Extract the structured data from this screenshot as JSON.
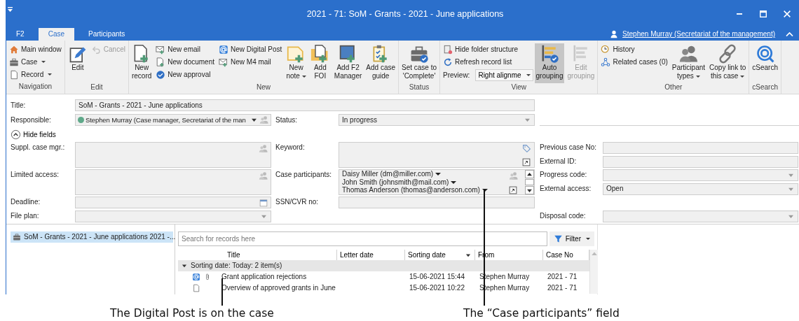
{
  "window": {
    "title": "2021 - 71: SoM - Grants - 2021 - June applications"
  },
  "tabs": [
    {
      "label": "F2",
      "selected": false
    },
    {
      "label": "Case",
      "selected": true
    },
    {
      "label": "Participants",
      "selected": false
    }
  ],
  "user": {
    "label": "Stephen Murray (Secretariat of the management)"
  },
  "ribbon": {
    "groups": [
      {
        "label": "Navigation",
        "items": [
          {
            "kind": "small",
            "label": "Main window",
            "disabled": false,
            "on": false
          },
          {
            "kind": "small",
            "label": "Case",
            "dropdown": true,
            "disabled": false,
            "on": false
          },
          {
            "kind": "small",
            "label": "Record",
            "dropdown": true,
            "disabled": false,
            "on": false
          }
        ]
      },
      {
        "label": "Edit",
        "items": [
          {
            "kind": "large",
            "label": "Edit",
            "disabled": false,
            "on": false
          },
          {
            "kind": "small",
            "label": "Cancel",
            "disabled": true,
            "on": false
          }
        ]
      },
      {
        "label": "New",
        "items": [
          {
            "kind": "large",
            "label": "New\nrecord",
            "disabled": false,
            "on": false
          },
          {
            "kind": "small",
            "label": "New email",
            "disabled": false,
            "on": false
          },
          {
            "kind": "small",
            "label": "New document",
            "disabled": false,
            "on": false
          },
          {
            "kind": "small",
            "label": "New approval",
            "disabled": false,
            "on": false
          },
          {
            "kind": "small",
            "label": "New Digital Post",
            "disabled": false,
            "on": false
          },
          {
            "kind": "small",
            "label": "New M4 mail",
            "disabled": false,
            "on": false
          },
          {
            "kind": "large",
            "label": "New\nnote",
            "dropdown": true,
            "disabled": false,
            "on": false
          },
          {
            "kind": "large",
            "label": "Add\nFOI",
            "disabled": false,
            "on": false
          },
          {
            "kind": "large",
            "label": "Add F2\nManager",
            "disabled": false,
            "on": false
          },
          {
            "kind": "large",
            "label": "Add case\nguide",
            "disabled": false,
            "on": false
          }
        ]
      },
      {
        "label": "Status",
        "items": [
          {
            "kind": "large",
            "label": "Set case to\n'Complete'",
            "disabled": false,
            "on": false
          }
        ]
      },
      {
        "label": "View",
        "items": [
          {
            "kind": "small",
            "label": "Hide folder structure",
            "disabled": false,
            "on": false
          },
          {
            "kind": "small",
            "label": "Refresh record list",
            "disabled": false,
            "on": false
          },
          {
            "kind": "combo",
            "label": "Preview:",
            "value": "Right alignme",
            "disabled": false,
            "on": false
          },
          {
            "kind": "large",
            "label": "Auto\ngrouping",
            "disabled": false,
            "on": true
          },
          {
            "kind": "large",
            "label": "Edit\ngrouping",
            "disabled": true,
            "on": false
          }
        ]
      },
      {
        "label": "Other",
        "items": [
          {
            "kind": "small",
            "label": "History",
            "disabled": false,
            "on": false
          },
          {
            "kind": "small",
            "label": "Related cases (0)",
            "disabled": false,
            "on": false
          },
          {
            "kind": "large",
            "label": "Participant\ntypes",
            "dropdown": true,
            "disabled": false,
            "on": false
          },
          {
            "kind": "large",
            "label": "Copy link to\nthis case",
            "dropdown": true,
            "disabled": false,
            "on": false
          }
        ]
      },
      {
        "label": "cSearch",
        "items": [
          {
            "kind": "large",
            "label": "cSearch",
            "disabled": false,
            "on": false
          }
        ]
      }
    ]
  },
  "form": {
    "title": {
      "label": "Title:",
      "value": "SoM - Grants - 2021 - June applications"
    },
    "responsible": {
      "label": "Responsible:",
      "value": "Stephen Murray (Case manager, Secretariat of the man",
      "color": "#5fa98a"
    },
    "status": {
      "label": "Status:",
      "value": "In progress"
    },
    "hide_fields": {
      "label": "Hide fields",
      "expanded": true
    },
    "columns": [
      [
        {
          "kind": "people",
          "label": "Suppl. case mgr.:"
        },
        {
          "kind": "people",
          "label": "Limited access:"
        },
        {
          "kind": "date",
          "label": "Deadline:"
        },
        {
          "kind": "select",
          "label": "File plan:"
        }
      ],
      [
        {
          "kind": "keyword",
          "label": "Keyword:"
        },
        {
          "kind": "participants",
          "label": "Case participants:",
          "participants": [
            "Daisy Miller (dm@miller.com)",
            "John Smith (johnsmith@mail.com)",
            "Thomas Anderson (thomas@anderson.com)"
          ]
        },
        {
          "kind": "text",
          "label": "SSN/CVR no:"
        }
      ],
      [
        {
          "kind": "text",
          "label": "Previous case No:"
        },
        {
          "kind": "text",
          "label": "External ID:"
        },
        {
          "kind": "select",
          "label": "Progress code:"
        },
        {
          "kind": "select",
          "label": "External access:",
          "value": "Open"
        },
        {
          "kind": "select",
          "label": "Disposal code:"
        }
      ]
    ]
  },
  "records": {
    "tree": [
      {
        "label": "SoM - Grants - 2021 - June applications 2021 -...",
        "selected": true
      }
    ],
    "search": {
      "placeholder": "Search for records here"
    },
    "filter": {
      "label": "Filter"
    },
    "columns": [
      {
        "label": "Title",
        "sorted": false
      },
      {
        "label": "Letter date",
        "sorted": false
      },
      {
        "label": "Sorting date",
        "sorted": true
      },
      {
        "label": "From",
        "sorted": false
      },
      {
        "label": "Case No",
        "sorted": false
      }
    ],
    "group": {
      "label": "Sorting date: Today: 2 item(s)",
      "expanded": true
    },
    "rows": [
      {
        "kind": "digital_post",
        "attachment": true,
        "title": "Grant application rejections",
        "sorting_date": "15-06-2021 15:44",
        "from": "Stephen Murray",
        "case_no": "2021 - 71"
      },
      {
        "kind": "document",
        "attachment": false,
        "title": "Overview of approved grants in June",
        "sorting_date": "15-06-2021 10:22",
        "from": "Stephen Murray",
        "case_no": "2021 - 71"
      }
    ]
  },
  "annotations": [
    {
      "text": "The Digital Post is on the case"
    },
    {
      "text": "The “Case participants” field"
    }
  ]
}
